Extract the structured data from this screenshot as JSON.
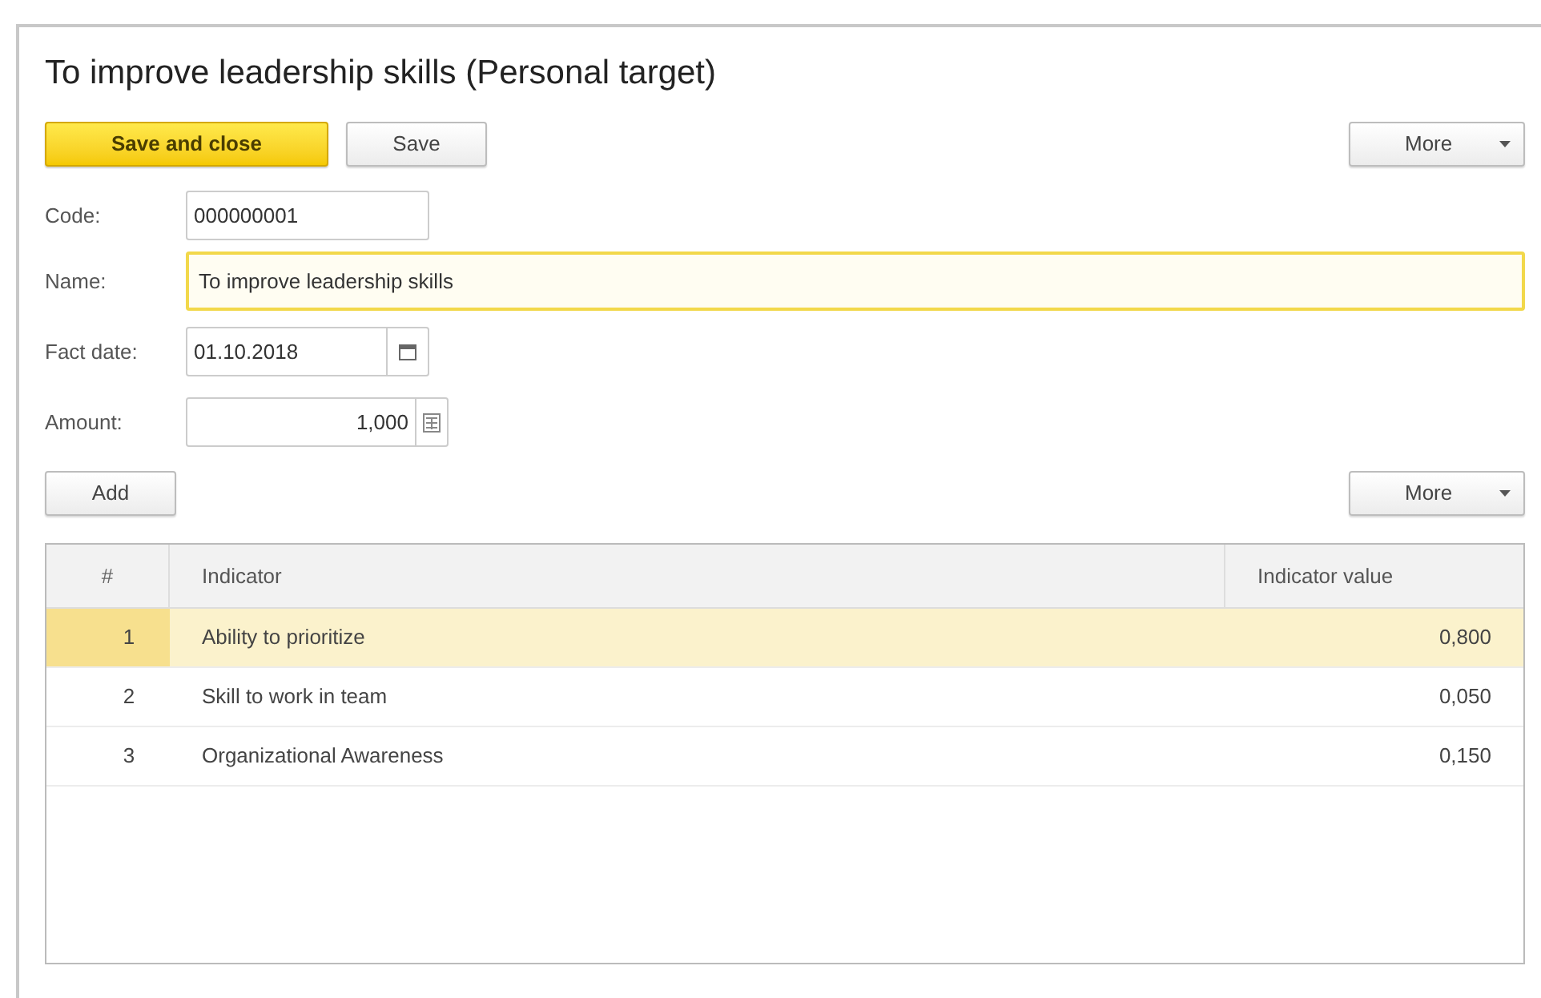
{
  "window": {
    "title": "To improve leadership skills (Personal target)"
  },
  "toolbar": {
    "save_and_close": "Save and close",
    "save": "Save",
    "more": "More"
  },
  "fields": {
    "code": {
      "label": "Code:",
      "value": "000000001"
    },
    "name": {
      "label": "Name:",
      "value": "To improve leadership skills",
      "focused": true
    },
    "fact_date": {
      "label": "Fact date:",
      "value": "01.10.2018"
    },
    "amount": {
      "label": "Amount:",
      "value": "1,000"
    }
  },
  "table_toolbar": {
    "add": "Add",
    "more": "More"
  },
  "table": {
    "columns": [
      "#",
      "Indicator",
      "Indicator value"
    ],
    "rows": [
      {
        "cells": [
          "1",
          "Ability to prioritize",
          "0,800"
        ],
        "selected": true
      },
      {
        "cells": [
          "2",
          "Skill to work in team",
          "0,050"
        ],
        "selected": false
      },
      {
        "cells": [
          "3",
          "Organizational Awareness",
          "0,150"
        ],
        "selected": false
      }
    ]
  }
}
